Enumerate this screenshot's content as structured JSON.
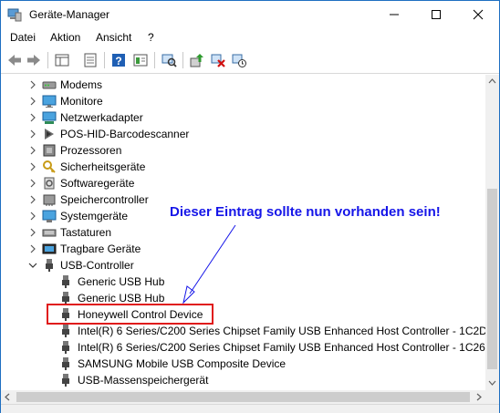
{
  "window": {
    "title": "Geräte-Manager",
    "accent_color": "#1e6fc1"
  },
  "menu": {
    "items": [
      "Datei",
      "Aktion",
      "Ansicht",
      "?"
    ]
  },
  "toolbar": {
    "icons": [
      "back-arrow-icon",
      "forward-arrow-icon",
      "show-hide-console-tree-icon",
      "properties-icon",
      "help-icon",
      "action-pane-icon",
      "scan-hardware-icon",
      "update-driver-icon",
      "uninstall-device-icon",
      "disable-device-icon"
    ]
  },
  "tree": {
    "categories": [
      {
        "label": "Modems",
        "icon": "modem-icon",
        "expanded": false
      },
      {
        "label": "Monitore",
        "icon": "monitor-icon",
        "expanded": false
      },
      {
        "label": "Netzwerkadapter",
        "icon": "network-adapter-icon",
        "expanded": false
      },
      {
        "label": "POS-HID-Barcodescanner",
        "icon": "barcode-scanner-icon",
        "expanded": false
      },
      {
        "label": "Prozessoren",
        "icon": "processor-icon",
        "expanded": false
      },
      {
        "label": "Sicherheitsgeräte",
        "icon": "security-key-icon",
        "expanded": false
      },
      {
        "label": "Softwaregeräte",
        "icon": "software-device-icon",
        "expanded": false
      },
      {
        "label": "Speichercontroller",
        "icon": "storage-controller-icon",
        "expanded": false
      },
      {
        "label": "Systemgeräte",
        "icon": "system-device-icon",
        "expanded": false
      },
      {
        "label": "Tastaturen",
        "icon": "keyboard-icon",
        "expanded": false
      },
      {
        "label": "Tragbare Geräte",
        "icon": "portable-device-icon",
        "expanded": false
      },
      {
        "label": "USB-Controller",
        "icon": "usb-plug-icon",
        "expanded": true
      }
    ],
    "usb_children": [
      {
        "label": "Generic USB Hub",
        "icon": "usb-plug-icon"
      },
      {
        "label": "Generic USB Hub",
        "icon": "usb-plug-icon"
      },
      {
        "label": "Honeywell Control Device",
        "icon": "usb-plug-icon",
        "highlighted": true
      },
      {
        "label": "Intel(R) 6 Series/C200 Series Chipset Family USB Enhanced Host Controller - 1C2D",
        "icon": "usb-plug-icon"
      },
      {
        "label": "Intel(R) 6 Series/C200 Series Chipset Family USB Enhanced Host Controller - 1C26",
        "icon": "usb-plug-icon"
      },
      {
        "label": "SAMSUNG Mobile USB Composite Device",
        "icon": "usb-plug-icon"
      },
      {
        "label": "USB-Massenspeichergerät",
        "icon": "usb-plug-icon"
      }
    ]
  },
  "annotation": {
    "text": "Dieser Eintrag sollte nun vorhanden sein!",
    "text_color": "#1515e8",
    "box_color": "#e01b1b"
  }
}
